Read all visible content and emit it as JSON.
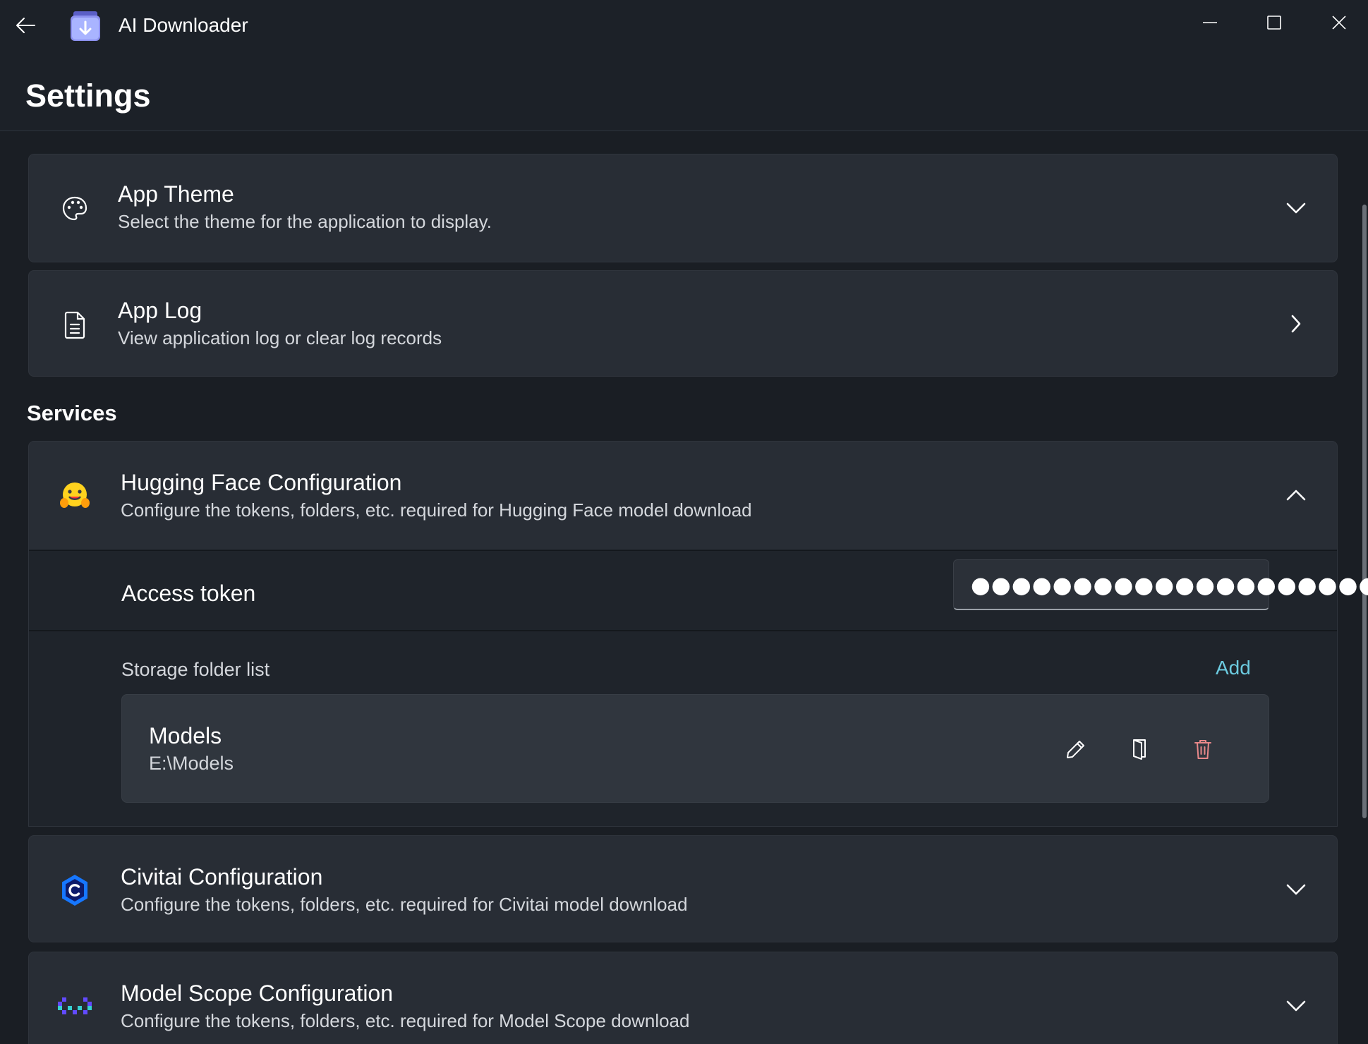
{
  "window": {
    "title": "AI Downloader"
  },
  "header": {
    "page_title": "Settings"
  },
  "settings": {
    "app_theme": {
      "title": "App Theme",
      "description": "Select the theme for the application to display.",
      "icon": "palette-icon",
      "state": "collapsed"
    },
    "app_log": {
      "title": "App Log",
      "description": "View application log or clear log records",
      "icon": "document-icon"
    }
  },
  "services": {
    "section_title": "Services",
    "hugging_face": {
      "title": "Hugging Face Configuration",
      "description": "Configure the tokens, folders, etc. required for Hugging Face model download",
      "icon": "hugging-face-logo",
      "state": "expanded",
      "access_token_label": "Access token",
      "access_token_value": "●●●●●●●●●●●●●●●●●●●●",
      "storage_folder_label": "Storage folder list",
      "add_label": "Add",
      "folders": [
        {
          "name": "Models",
          "path": "E:\\Models"
        }
      ]
    },
    "civitai": {
      "title": "Civitai Configuration",
      "description": "Configure the tokens, folders, etc. required for Civitai model download",
      "icon": "civitai-logo",
      "state": "collapsed"
    },
    "model_scope": {
      "title": "Model Scope Configuration",
      "description": "Configure the tokens, folders, etc. required for Model Scope download",
      "icon": "model-scope-logo",
      "state": "collapsed"
    }
  },
  "colors": {
    "background": "#1a1e24",
    "card": "#282d35",
    "accent_link": "#6ccbe0",
    "delete": "#e8888a"
  }
}
